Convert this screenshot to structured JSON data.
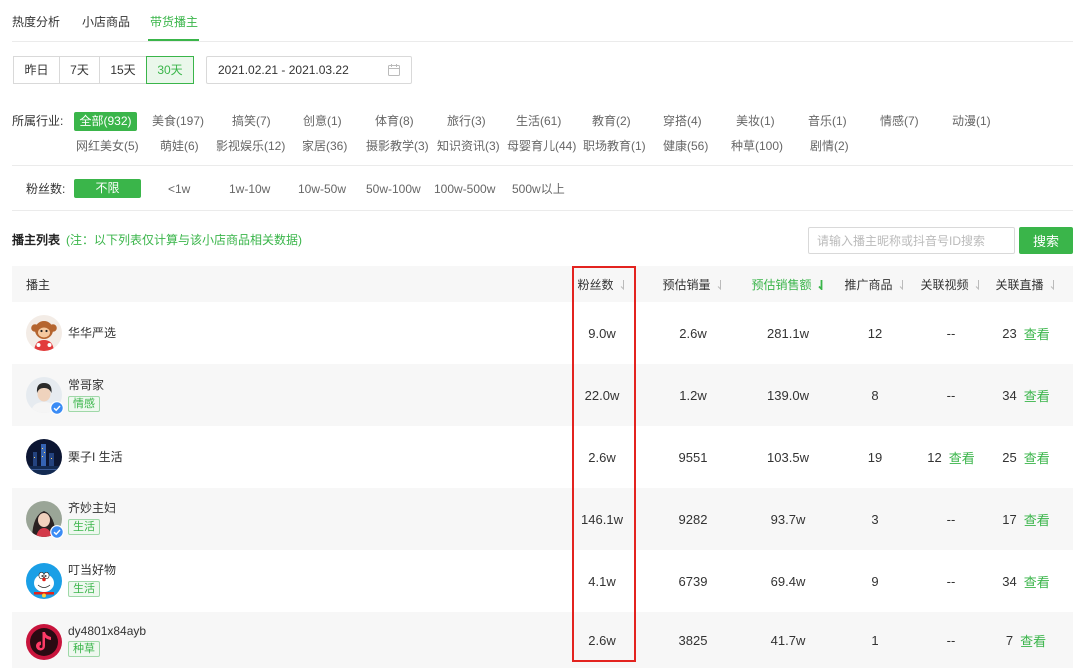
{
  "colors": {
    "accent": "#3ab54a",
    "highlight": "#e3231f",
    "verified": "#3b8cf5"
  },
  "tabs": [
    {
      "label": "热度分析"
    },
    {
      "label": "小店商品"
    },
    {
      "label": "带货播主",
      "active": true
    }
  ],
  "date_filter": {
    "buttons": [
      {
        "label": "昨日"
      },
      {
        "label": "7天"
      },
      {
        "label": "15天"
      },
      {
        "label": "30天",
        "active": true
      }
    ],
    "range": "2021.02.21 - 2021.03.22",
    "range_icon": "calendar-icon"
  },
  "industry_filter": {
    "label": "所属行业:",
    "selected": "全部(932)",
    "options": [
      "全部(932)",
      "美食(197)",
      "搞笑(7)",
      "创意(1)",
      "体育(8)",
      "旅行(3)",
      "生活(61)",
      "教育(2)",
      "穿搭(4)",
      "美妆(1)",
      "音乐(1)",
      "情感(7)",
      "动漫(1)",
      "网红美女(5)",
      "萌娃(6)",
      "影视娱乐(12)",
      "家居(36)",
      "摄影教学(3)",
      "知识资讯(3)",
      "母婴育儿(44)",
      "职场教育(1)",
      "健康(56)",
      "种草(100)",
      "剧情(2)"
    ]
  },
  "fans_filter": {
    "label": "粉丝数:",
    "selected": "不限",
    "options": [
      "不限",
      "<1w",
      "1w-10w",
      "10w-50w",
      "50w-100w",
      "100w-500w",
      "500w以上"
    ]
  },
  "list": {
    "title": "播主列表",
    "note": "(注：以下列表仅计算与该小店商品相关数据)"
  },
  "search": {
    "placeholder": "请输入播主昵称或抖音号ID搜索",
    "button": "搜索"
  },
  "table": {
    "sort_icon": "sort-down-arrow-icon",
    "headers": [
      {
        "label": "播主"
      },
      {
        "label": "粉丝数",
        "sortable": true
      },
      {
        "label": "预估销量",
        "sortable": true
      },
      {
        "label": "预估销售额",
        "sortable": true,
        "active": true
      },
      {
        "label": "推广商品",
        "sortable": true
      },
      {
        "label": "关联视频",
        "sortable": true
      },
      {
        "label": "关联直播",
        "sortable": true
      }
    ],
    "rows": [
      {
        "name": "华华严选",
        "fans": "9.0w",
        "sales": "2.6w",
        "revenue": "281.1w",
        "products": "12",
        "videos": "--",
        "live": "23",
        "live_link": "查看"
      },
      {
        "name": "常哥家",
        "tag": "情感",
        "verified": true,
        "fans": "22.0w",
        "sales": "1.2w",
        "revenue": "139.0w",
        "products": "8",
        "videos": "--",
        "live": "34",
        "live_link": "查看"
      },
      {
        "name": "栗子I 生活",
        "fans": "2.6w",
        "sales": "9551",
        "revenue": "103.5w",
        "products": "19",
        "videos": "12",
        "videos_link": "查看",
        "live": "25",
        "live_link": "查看"
      },
      {
        "name": "齐妙主妇",
        "tag": "生活",
        "verified": true,
        "fans": "146.1w",
        "sales": "9282",
        "revenue": "93.7w",
        "products": "3",
        "videos": "--",
        "live": "17",
        "live_link": "查看"
      },
      {
        "name": "叮当好物",
        "tag": "生活",
        "fans": "4.1w",
        "sales": "6739",
        "revenue": "69.4w",
        "products": "9",
        "videos": "--",
        "live": "34",
        "live_link": "查看"
      },
      {
        "name": "dy4801x84ayb",
        "tag": "种草",
        "fans": "2.6w",
        "sales": "3825",
        "revenue": "41.7w",
        "products": "1",
        "videos": "--",
        "live": "7",
        "live_link": "查看"
      }
    ]
  }
}
